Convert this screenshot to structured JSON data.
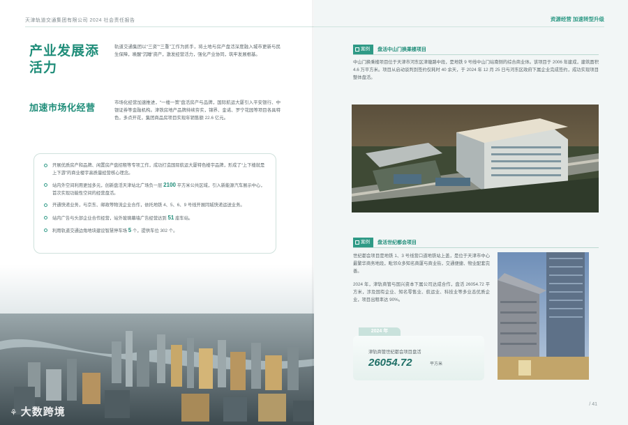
{
  "header": {
    "left": "天津轨道交通集团有限公司 2024 社会责任报告",
    "right": "资源经营 加速转型升级"
  },
  "left_page": {
    "title1": "产业发展添活力",
    "intro": "轨道交通集团以“三资”“三重”工作为抓手，将土地与房产盘活深度融入城市更新与民生保障，唤醒“沉睡”资产，激发经营活力，强化产业协同，筑牢发展根基。",
    "title2": "加速市场化经营",
    "p2": "市场化经营加速推进，“一楼一策”盘活房产与品牌，国际航运大厦引入平安银行、中银证券等金融机构。津铁房地产品牌持续夯实，锦界、金诺、罗宁花园等项目各具特色，多点开花，集团商品房项目实现年销售额 22.6 亿元。",
    "bullets": [
      {
        "pre": "开展优质房产和品牌、闲置房产盘招租等专项工作，成功打造国际航运大厦特色楼宇品牌，形成了“上下楼就是上下游”的商业楼宇高质量经营核心理念。",
        "em": "",
        "post": ""
      },
      {
        "pre": "站内外空间利用更加多元，创新盘活天津站北广场负一层 ",
        "em": "2100",
        "post": " 平方米公共区域，引入新能源汽车展示中心，首次实现功能性空间的经营盘活。"
      },
      {
        "pre": "开通快递业务，与京东、邮政等物流企业合作，依托地铁 4、5、6、9 号线开展同城快递运送业务。",
        "em": "",
        "post": ""
      },
      {
        "pre": "站内广告与头部企业合作经营，站外玻璃幕墙广告经营达到 ",
        "em": "51",
        "post": " 座车站。"
      },
      {
        "pre": "利用轨道交通边角地块建设智慧停车场 ",
        "em": "5",
        "post": " 个，提供车位 302 个。"
      }
    ],
    "logo": "大数跨境",
    "logo_mark": "⚘"
  },
  "right_page": {
    "case_label": "案例",
    "case1": {
      "title": "盘活中山门换乘楼项目",
      "text": "中山门换乘楼项目位于天津市河东区津塘路中段，是地铁 9 号线中山门站南侧的综合商业体。该项目于 2006 年建成，建筑面积 4.6 万平方米。项目从启动谈判到签约仅耗时 40 余天，于 2024 年 12 月 25 日与河东区政府下属企业完成签约，成功实现项目整体盘活。"
    },
    "case2": {
      "title": "盘活世纪都会项目",
      "p1": "世纪都会项目是地铁 1、3 号线营口道地铁站上盖，是位于天津市中心最繁华商务地段，毗邻众多知名商厦与商业街，交通便捷、物业配套完善。",
      "p2": "2024 年，津轨商管与国兴资本下属公司达成合作，盘活 26054.72 平方米，涉及国有企业、知名零售业、航运业、科技业等多业态优质企业，项目出租率达 90%。"
    },
    "stat": {
      "year": "2024 年",
      "caption": "津轨商管世纪都会项目盘活",
      "value": "26054.72",
      "unit": "平方米"
    },
    "page_number": "/ 41"
  }
}
